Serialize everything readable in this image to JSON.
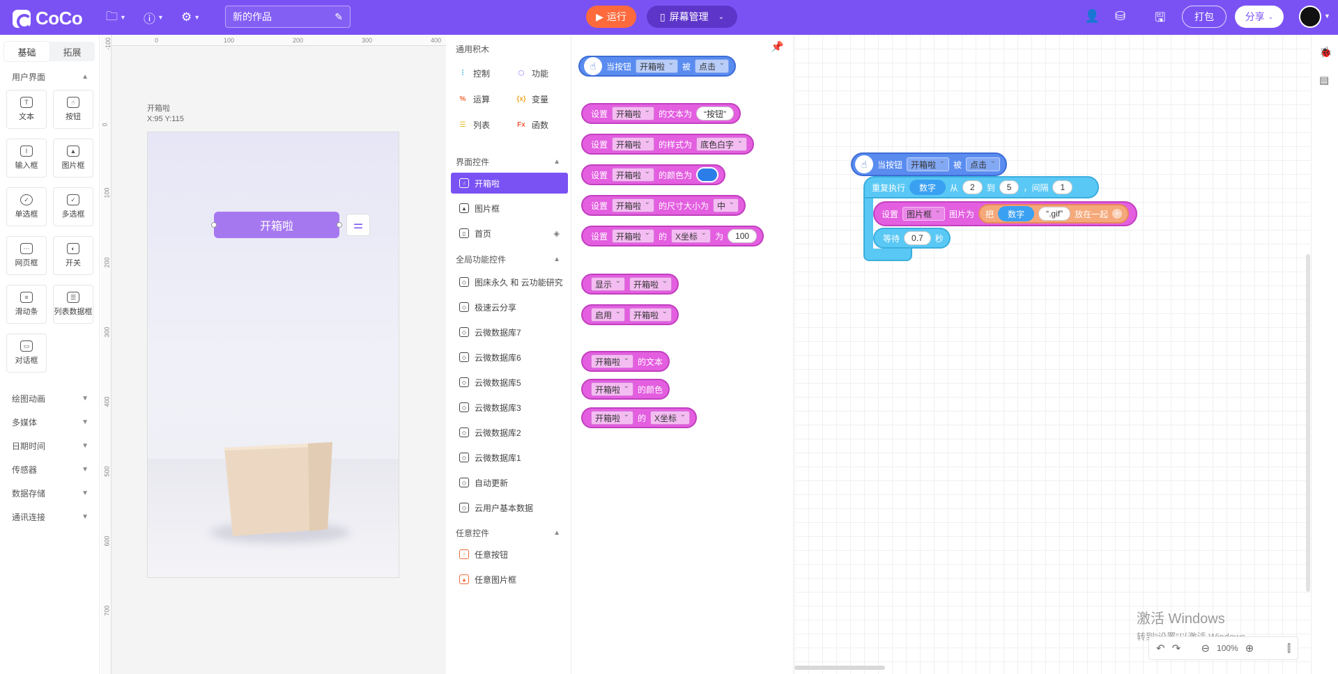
{
  "topbar": {
    "logo": "CoCo",
    "project_name": "新的作品",
    "run_label": "运行",
    "screen_mgmt_label": "屏幕管理",
    "pack_label": "打包",
    "share_label": "分享",
    "accent": "#7a52f4"
  },
  "leftbar": {
    "tabs": [
      "基础",
      "拓展"
    ],
    "ui_section": "用户界面",
    "widgets": [
      "文本",
      "按钮",
      "输入框",
      "图片框",
      "单选框",
      "多选框",
      "网页框",
      "开关",
      "滑动条",
      "列表数据框",
      "对话框"
    ],
    "sections": [
      "绘图动画",
      "多媒体",
      "日期时间",
      "传感器",
      "数据存储",
      "通讯连接"
    ]
  },
  "stage": {
    "ruler_h": [
      "0",
      "100",
      "200",
      "300",
      "400"
    ],
    "ruler_v": [
      "-100",
      "0",
      "100",
      "200",
      "300",
      "400",
      "500",
      "600",
      "700"
    ],
    "selected_name": "开箱啦",
    "selected_pos": "X:95 Y:115",
    "button_text": "开箱啦"
  },
  "categories": {
    "general_title": "通用积木",
    "general": [
      "控制",
      "功能",
      "运算",
      "变量",
      "列表",
      "函数"
    ],
    "ui_title": "界面控件",
    "ui_controls": [
      "开箱啦",
      "图片框",
      "首页"
    ],
    "global_title": "全局功能控件",
    "global_controls": [
      "图床永久 和 云功能研究",
      "极速云分享",
      "云微数据库7",
      "云微数据库6",
      "云微数据库5",
      "云微数据库3",
      "云微数据库2",
      "云微数据库1",
      "自动更新",
      "云用户基本数据"
    ],
    "any_title": "任意控件",
    "any_controls": [
      "任意按钮",
      "任意图片框"
    ]
  },
  "palette": {
    "hat": {
      "when": "当按钮",
      "target": "开箱啦",
      "by": "被",
      "event": "点击"
    },
    "set_text": {
      "set": "设置",
      "target": "开箱啦",
      "label": "的文本为",
      "value": "“按钮”"
    },
    "set_style": {
      "set": "设置",
      "target": "开箱啦",
      "label": "的样式为",
      "value": "底色白字"
    },
    "set_color": {
      "set": "设置",
      "target": "开箱啦",
      "label": "的颜色为",
      "color": "#2c7de8"
    },
    "set_size": {
      "set": "设置",
      "target": "开箱啦",
      "label": "的尺寸大小为",
      "value": "中"
    },
    "set_x": {
      "set": "设置",
      "target": "开箱啦",
      "of": "的",
      "prop": "X坐标",
      "to": "为",
      "value": "100"
    },
    "show": {
      "action": "显示",
      "target": "开箱啦"
    },
    "enable": {
      "action": "启用",
      "target": "开箱啦"
    },
    "get_text": {
      "target": "开箱啦",
      "label": "的文本"
    },
    "get_color": {
      "target": "开箱啦",
      "label": "的颜色"
    },
    "get_x": {
      "target": "开箱啦",
      "of": "的",
      "prop": "X坐标"
    }
  },
  "workspace": {
    "hat": {
      "when": "当按钮",
      "target": "开箱啦",
      "by": "被",
      "event": "点击"
    },
    "loop": {
      "label": "重复执行",
      "var": "数字",
      "from": "从",
      "start": "2",
      "to": "到",
      "end": "5",
      "step_label": "，间隔",
      "step": "1"
    },
    "set_image": {
      "set": "设置",
      "target": "图片框",
      "label": "图片为",
      "join_label": "把",
      "var": "数字",
      "suffix": "“.gif”",
      "join_end": "放在一起"
    },
    "wait": {
      "label": "等待",
      "value": "0.7",
      "unit": "秒"
    },
    "zoom": "100%",
    "watermark_title": "激活 Windows",
    "watermark_sub": "转到“设置”以激活 Windows。"
  }
}
